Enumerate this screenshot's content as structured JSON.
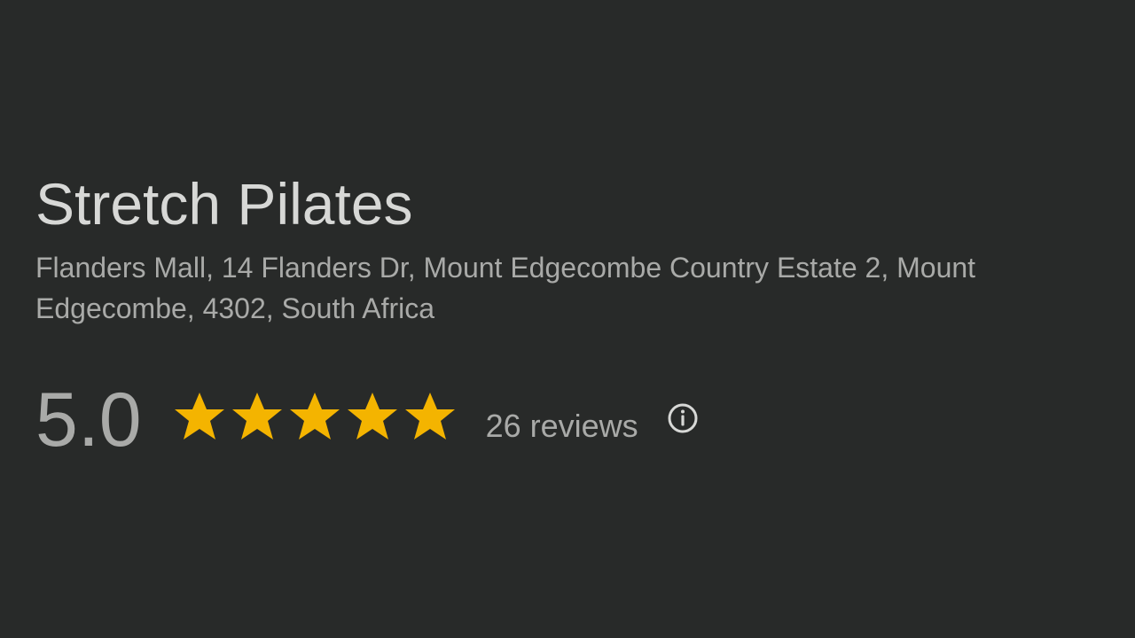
{
  "place": {
    "title": "Stretch Pilates",
    "address": "Flanders Mall, 14 Flanders Dr, Mount Edgecombe Country Estate 2, Mount Edgecombe, 4302, South Africa"
  },
  "rating": {
    "value": "5.0",
    "stars_filled": 5,
    "stars_total": 5,
    "reviews_label": "26 reviews",
    "star_color": "#f4b400"
  },
  "icons": {
    "star": "star-icon",
    "info": "info-icon"
  },
  "colors": {
    "background": "#282a29",
    "title": "#d7d8d6",
    "secondary_text": "#a9aaa8"
  }
}
